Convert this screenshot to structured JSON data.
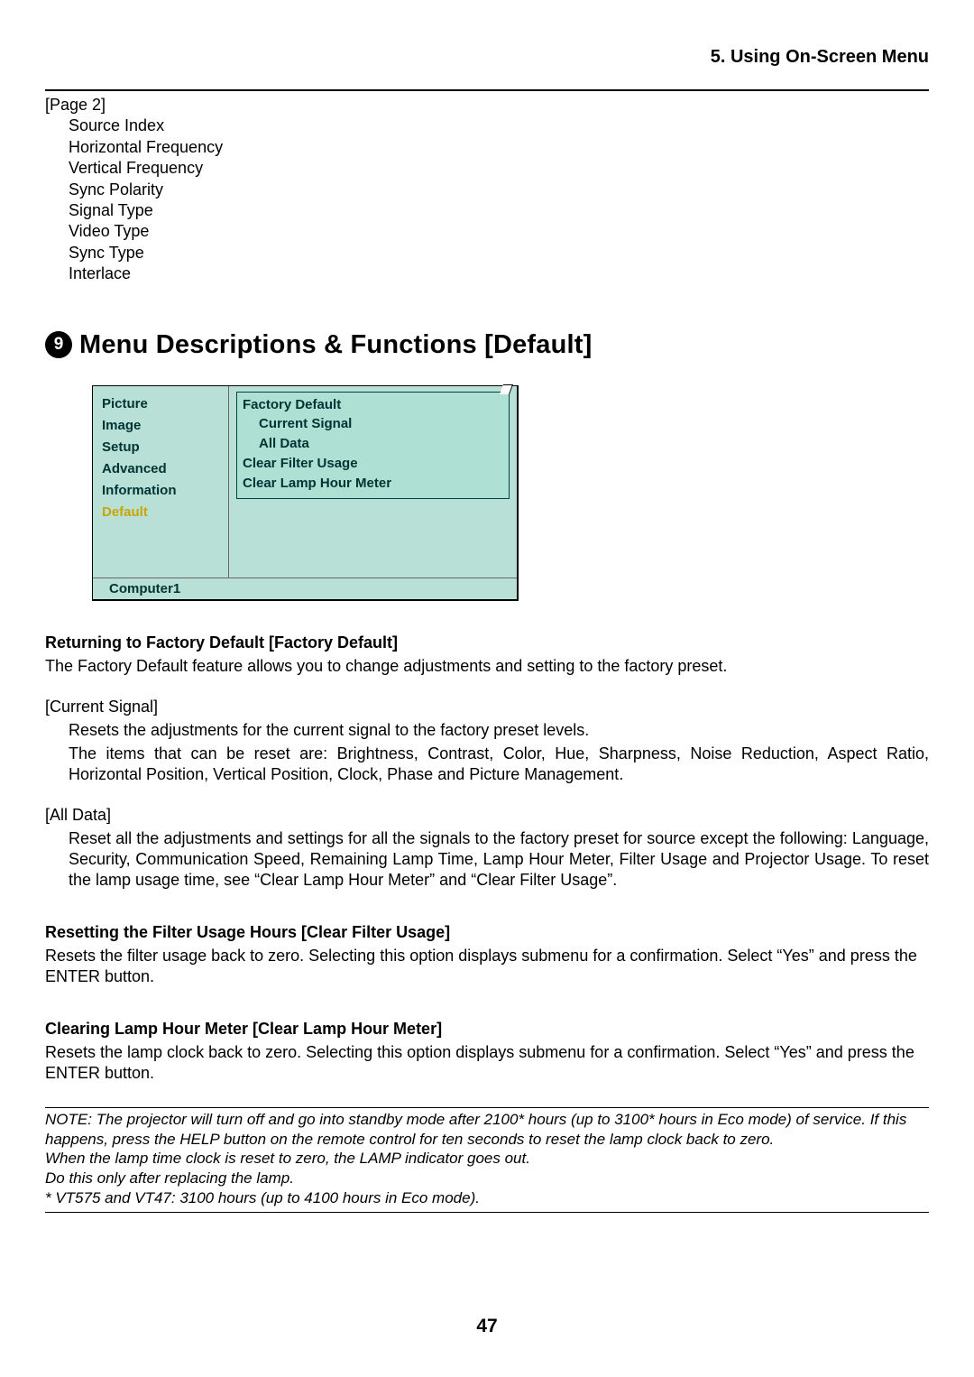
{
  "header": {
    "section_title": "5. Using On-Screen Menu"
  },
  "page2_list": {
    "heading": "[Page 2]",
    "items": [
      "Source Index",
      "Horizontal Frequency",
      "Vertical Frequency",
      "Sync Polarity",
      "Signal Type",
      "Video Type",
      "Sync Type",
      "Interlace"
    ]
  },
  "section": {
    "number": "9",
    "title": "Menu Descriptions & Functions [Default]"
  },
  "osd": {
    "left_items": [
      "Picture",
      "Image",
      "Setup",
      "Advanced",
      "Information",
      "Default"
    ],
    "selected_index": 5,
    "right": {
      "group_label": "Factory Default",
      "subitems": [
        "Current Signal",
        "All Data"
      ],
      "items": [
        "Clear Filter Usage",
        "Clear Lamp Hour Meter"
      ]
    },
    "status": "Computer1"
  },
  "sections": {
    "factory_default": {
      "heading": "Returning to Factory Default [Factory Default]",
      "intro": "The Factory Default feature allows you to change adjustments and setting to the factory preset.",
      "current_signal_label": "[Current Signal]",
      "current_signal_p1": "Resets the adjustments for the current signal to the factory preset levels.",
      "current_signal_p2": "The items that can be reset are: Brightness, Contrast, Color, Hue, Sharpness, Noise Reduction, Aspect Ratio, Horizontal Position, Vertical Position, Clock, Phase and Picture Management.",
      "all_data_label": "[All Data]",
      "all_data_p": "Reset all the adjustments and settings for all the signals to the factory preset for source except the following: Language, Security, Communication Speed, Remaining Lamp Time, Lamp Hour Meter, Filter Usage and Projector Usage. To reset the lamp usage time, see “Clear Lamp Hour Meter” and “Clear Filter Usage”."
    },
    "clear_filter": {
      "heading": "Resetting the Filter Usage Hours [Clear Filter Usage]",
      "body": "Resets the filter usage back to zero. Selecting this option displays submenu for a confirmation. Select “Yes” and press the ENTER button."
    },
    "clear_lamp": {
      "heading": "Clearing Lamp Hour Meter [Clear Lamp Hour Meter]",
      "body": "Resets the lamp clock back to zero. Selecting this option displays submenu for a confirmation. Select “Yes” and press the ENTER button."
    }
  },
  "note": {
    "line1": "NOTE: The projector will turn off and go into standby mode after 2100* hours (up to 3100* hours in Eco mode) of service. If this happens, press the HELP button on the remote control for ten seconds to reset the lamp clock back to zero.",
    "line2": "When the lamp time clock is reset to zero, the LAMP indicator goes out.",
    "line3": "Do this only after replacing the lamp.",
    "line4": "* VT575 and VT47: 3100 hours (up to 4100 hours in Eco mode)."
  },
  "page_number": "47"
}
